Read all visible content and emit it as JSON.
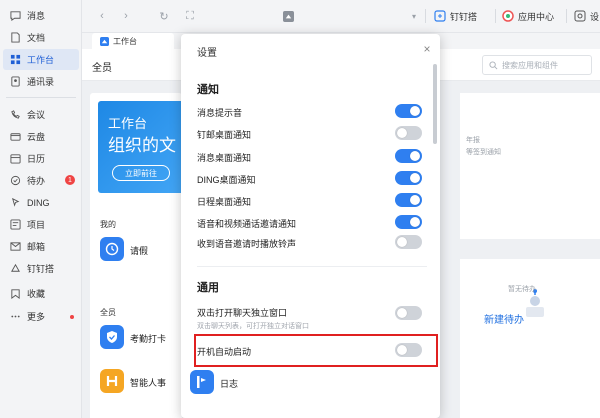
{
  "sidebar": {
    "items": [
      {
        "label": "消息",
        "icon": "message-icon"
      },
      {
        "label": "文档",
        "icon": "document-icon"
      },
      {
        "label": "工作台",
        "icon": "workbench-icon",
        "active": true
      },
      {
        "label": "通讯录",
        "icon": "contacts-icon"
      },
      {
        "label": "会议",
        "icon": "meeting-icon"
      },
      {
        "label": "云盘",
        "icon": "cloud-disk-icon"
      },
      {
        "label": "日历",
        "icon": "calendar-icon"
      },
      {
        "label": "待办",
        "icon": "todo-icon",
        "badge": "1"
      },
      {
        "label": "DING",
        "icon": "ding-icon"
      },
      {
        "label": "项目",
        "icon": "project-icon"
      },
      {
        "label": "邮箱",
        "icon": "mail-icon"
      },
      {
        "label": "钉钉搭",
        "icon": "dingda-icon"
      },
      {
        "label": "收藏",
        "icon": "favorites-icon"
      },
      {
        "label": "更多",
        "icon": "more-icon"
      }
    ]
  },
  "topbar": {
    "dingda": "钉钉搭",
    "app_center": "应用中心",
    "settings": "设"
  },
  "tab": {
    "label": "工作台"
  },
  "main": {
    "panel_title": "全员",
    "search_placeholder": "搜索应用和组件",
    "banner": {
      "line1": "工作台",
      "line2": "组织的文",
      "button": "立即前往"
    },
    "right_card": {
      "text1": "年报",
      "text2": "等签到通知"
    },
    "apps": {
      "mine_title": "我的",
      "leave": "请假",
      "all_title": "全员",
      "attendance": "考勤打卡",
      "hr": "智能人事",
      "log": "日志"
    },
    "todo": {
      "empty": "暂无待办",
      "new": "新建待办"
    }
  },
  "dialog": {
    "title": "设置",
    "close": "×",
    "notify_title": "通知",
    "notify_items": [
      {
        "label": "消息提示音",
        "on": true
      },
      {
        "label": "钉邮桌面通知",
        "on": false
      },
      {
        "label": "消息桌面通知",
        "on": true
      },
      {
        "label": "DING桌面通知",
        "on": true
      },
      {
        "label": "日程桌面通知",
        "on": true
      },
      {
        "label": "语音和视频通话邀请通知",
        "on": true
      },
      {
        "label": "收到语音邀请时播放铃声",
        "on": false
      }
    ],
    "general_title": "通用",
    "general_items": [
      {
        "label": "双击打开聊天独立窗口",
        "sub": "双击聊天列表，可打开独立对话窗口",
        "on": false
      },
      {
        "label": "开机自动启动",
        "on": false
      }
    ]
  },
  "colors": {
    "accent": "#2f7ff0",
    "highlight": "#e02020",
    "badge": "#ef4444"
  }
}
